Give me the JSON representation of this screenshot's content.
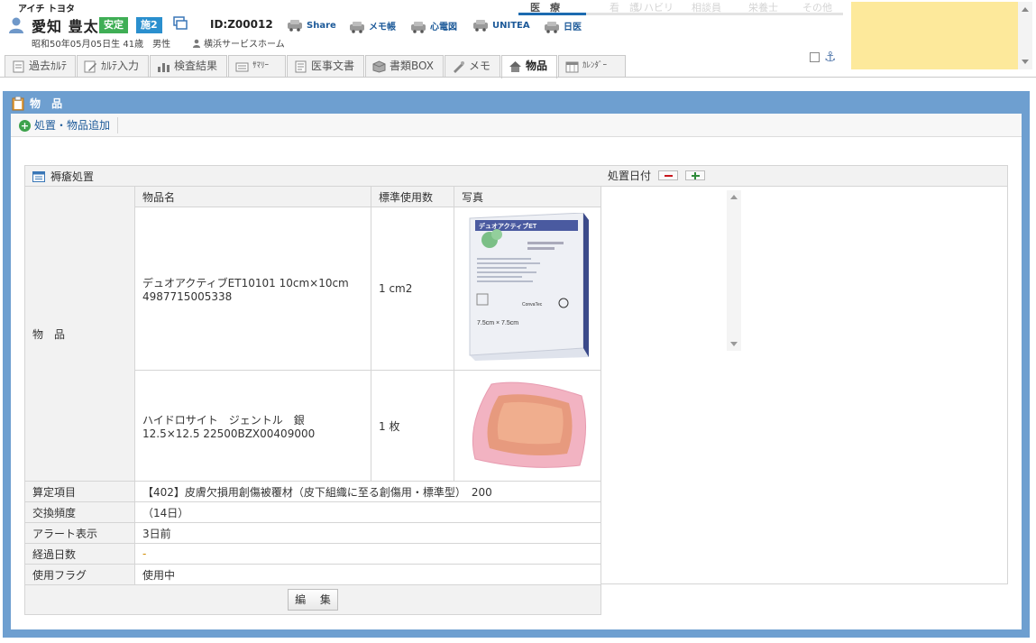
{
  "patient": {
    "kana": "アイチ トヨタ",
    "name": "愛知 豊太",
    "badge_status": "安定",
    "badge_facility": "施2",
    "id": "ID:Z00012",
    "dob": "昭和50年05月05日生 41歳　男性",
    "facility": "横浜サービスホーム"
  },
  "header_links": [
    {
      "label": "Share"
    },
    {
      "label": "メモ帳"
    },
    {
      "label": "心電図"
    },
    {
      "label": "UNITEA"
    },
    {
      "label": "日医"
    }
  ],
  "role_tabs": [
    "医　療",
    "看　護",
    "リハビリ",
    "相談員",
    "栄養士",
    "その他"
  ],
  "main_tabs": [
    {
      "label": "過去ｶﾙﾃ",
      "icon": "doc-icon"
    },
    {
      "label": "ｶﾙﾃ入力",
      "icon": "pencil-icon"
    },
    {
      "label": "検査結果",
      "icon": "bar-chart-icon"
    },
    {
      "label": "ｻﾏﾘｰ",
      "icon": "summary-icon"
    },
    {
      "label": "医事文書",
      "icon": "document-icon"
    },
    {
      "label": "書類BOX",
      "icon": "box-icon"
    },
    {
      "label": "メモ",
      "icon": "memo-icon"
    },
    {
      "label": "物品",
      "icon": "house-icon"
    },
    {
      "label": "ｶﾚﾝﾀﾞｰ",
      "icon": "calendar-icon"
    }
  ],
  "panel": {
    "title": "物 品",
    "add_button": "処置・物品追加"
  },
  "table": {
    "section_title": "褥瘡処置",
    "row_label": "物　品",
    "headers": {
      "name": "物品名",
      "qty": "標準使用数",
      "photo": "写真"
    },
    "items": [
      {
        "name": "デュオアクティブET10101 10cm×10cm 4987715005338",
        "qty": "1 cm2",
        "photo_alt": "デュオアクティブET package"
      },
      {
        "name": "ハイドロサイト　ジェントル　銀 12.5×12.5 22500BZX00409000",
        "qty": "1 枚",
        "photo_alt": "ハイドロサイト pad"
      }
    ],
    "fields": [
      {
        "label": "算定項目",
        "value": "【402】皮膚欠損用創傷被覆材（皮下組織に至る創傷用・標準型）　200"
      },
      {
        "label": "交換頻度",
        "value": "（14日）"
      },
      {
        "label": "アラート表示",
        "value": "3日前"
      },
      {
        "label": "経過日数",
        "value": "-"
      },
      {
        "label": "使用フラグ",
        "value": "使用中"
      }
    ],
    "edit_button": "編 集"
  },
  "date_panel": {
    "title": "処置日付"
  },
  "photo_texts": {
    "brand": "デュオアクティブET",
    "size": "7.5cm × 7.5cm",
    "maker": "ConvaTec"
  },
  "colors": {
    "panel_blue": "#6e9fd0",
    "badge_green": "#3fae55",
    "badge_blue": "#2a8fce",
    "memo_yellow": "#fde99b"
  }
}
